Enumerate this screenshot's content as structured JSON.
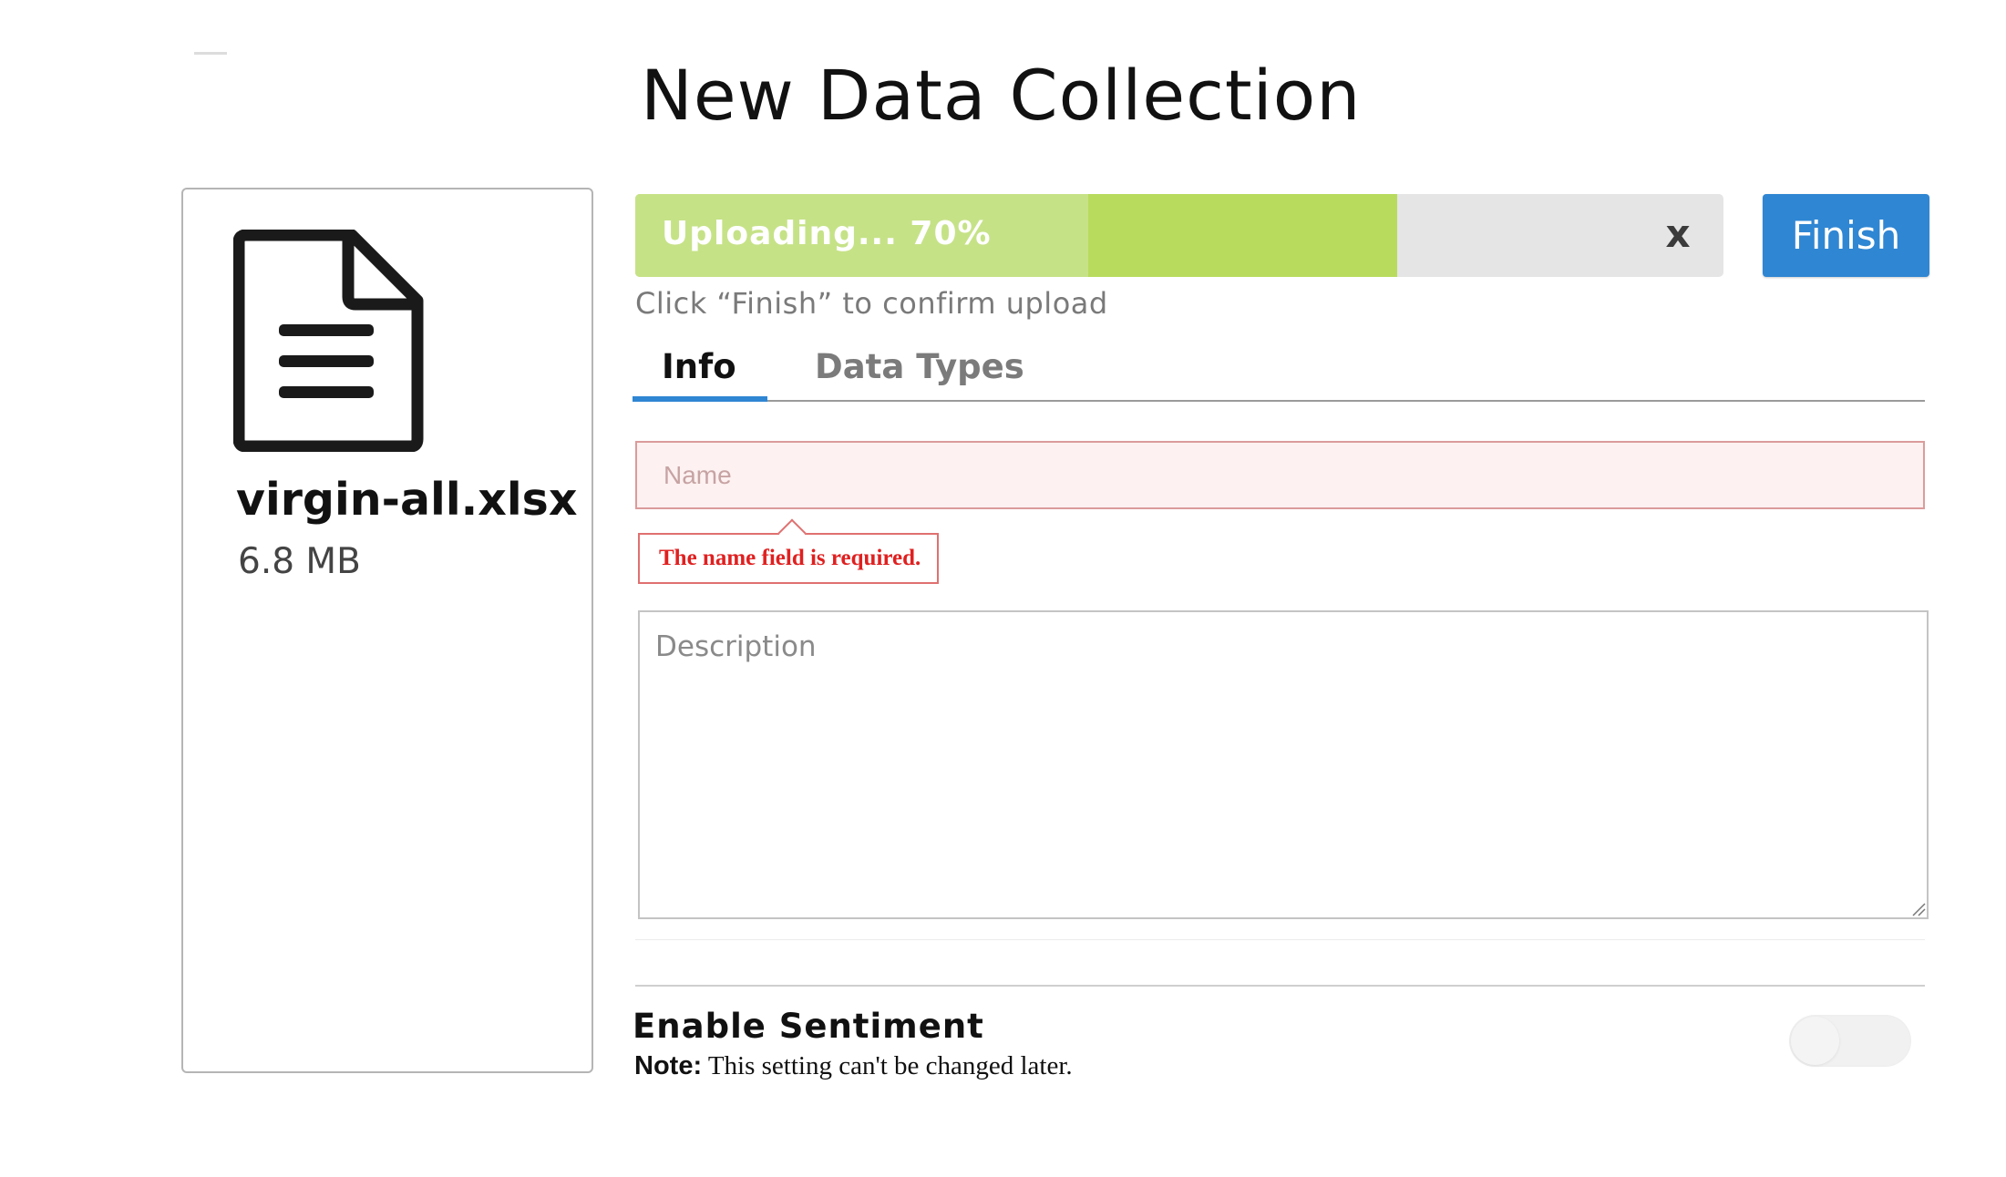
{
  "page": {
    "title": "New Data Collection"
  },
  "file": {
    "icon": "document-icon",
    "name": "virgin-all.xlsx",
    "size": "6.8 MB"
  },
  "upload": {
    "label": "Uploading... 70%",
    "progress": 0.7,
    "cancel_label": "x",
    "hint": "Click “Finish” to confirm upload",
    "finish_label": "Finish",
    "colors": {
      "fill": "#b8db5e",
      "track": "#e5e5e5",
      "finish_bg": "#2f86d3"
    }
  },
  "tabs": [
    {
      "label": "Info",
      "active": true
    },
    {
      "label": "Data Types",
      "active": false
    }
  ],
  "form": {
    "name_placeholder": "Name",
    "name_value": "",
    "name_error": "The name field is required.",
    "description_placeholder": "Description",
    "description_value": ""
  },
  "sentiment": {
    "title": "Enable Sentiment",
    "note_label": "Note:",
    "note_text": " This setting can't be changed later.",
    "enabled": false
  }
}
